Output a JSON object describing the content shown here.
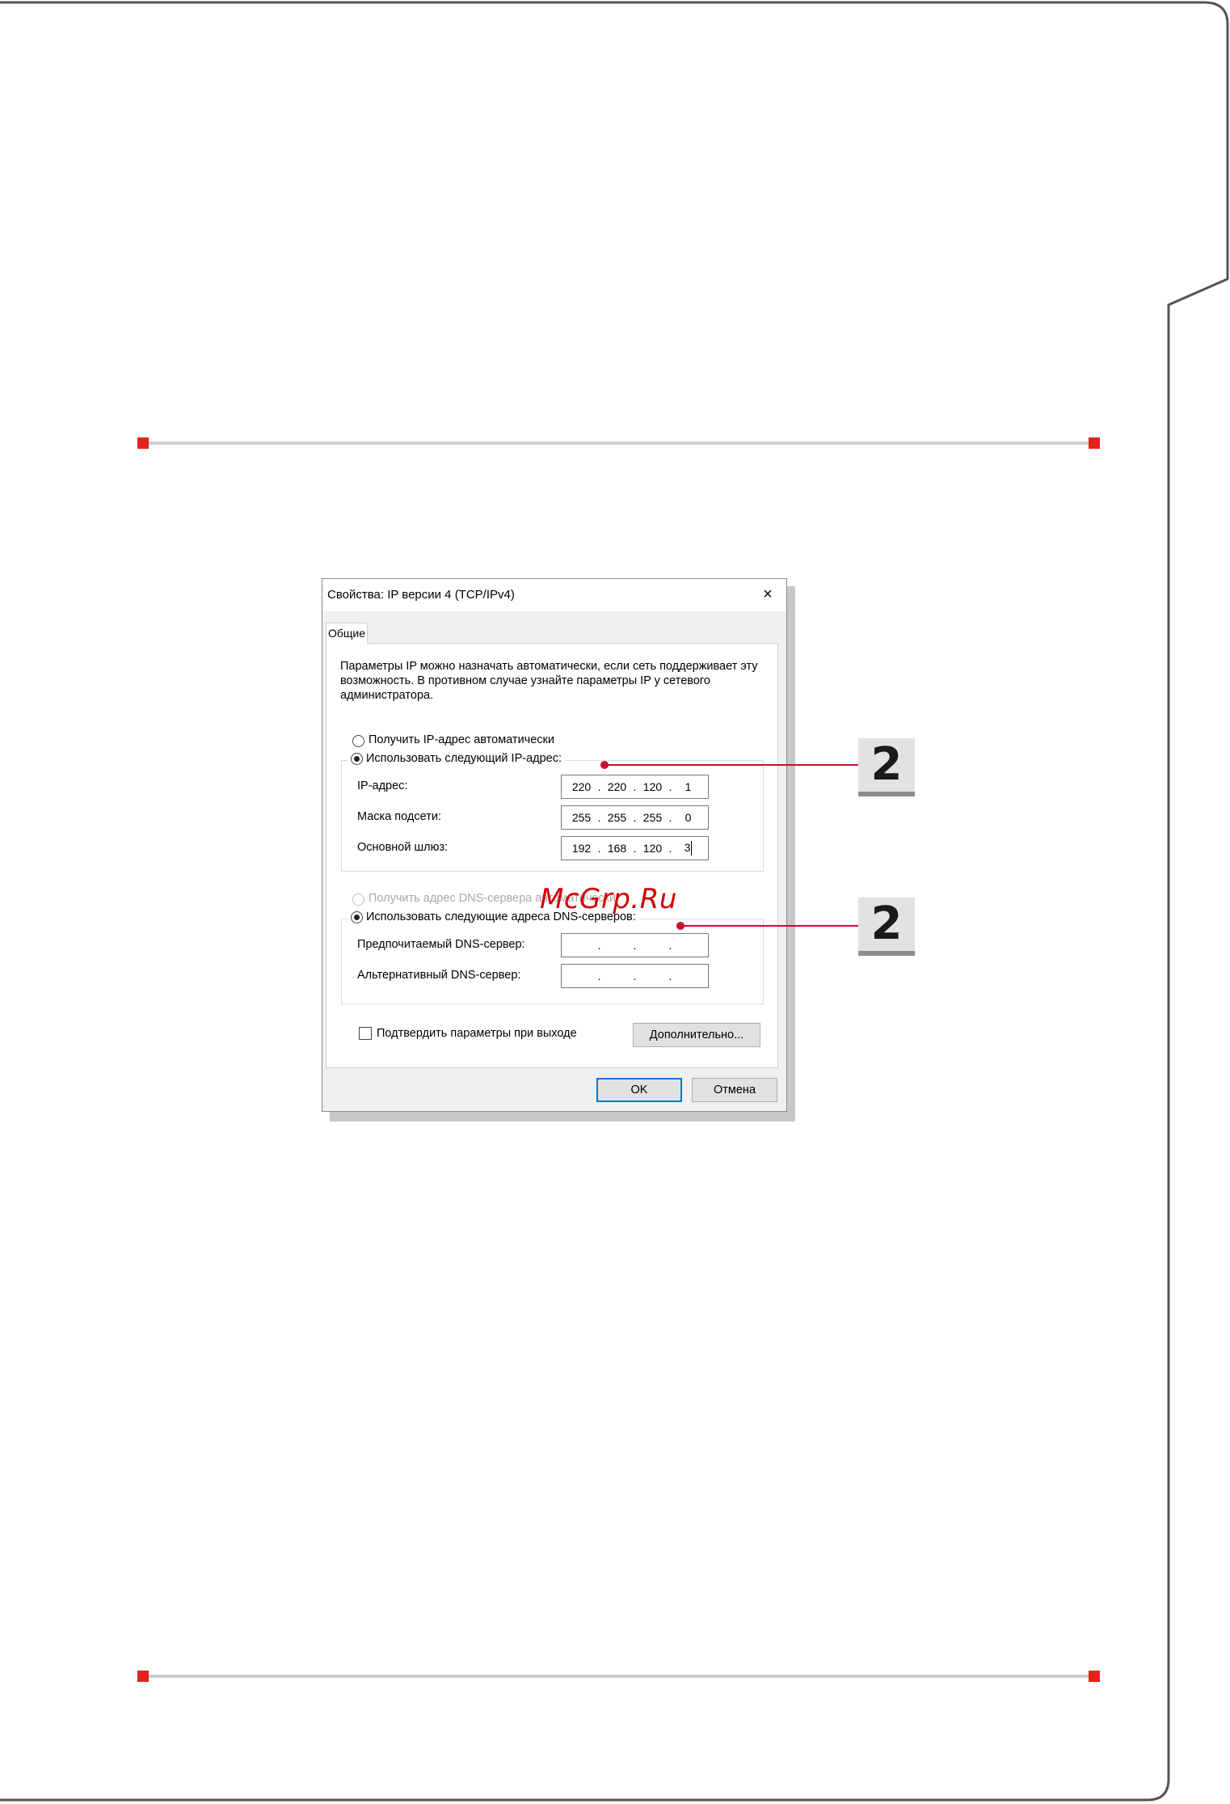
{
  "colors": {
    "accent_red": "#e2231a",
    "callout_red": "#c8102e",
    "focus_blue": "#0078d7"
  },
  "dialog": {
    "title": "Свойства: IP версии 4 (TCP/IPv4)",
    "close_glyph": "×",
    "tab_label": "Общие",
    "description": "Параметры IP можно назначать автоматически, если сеть поддерживает эту возможность. В противном случае узнайте параметры IP у сетевого администратора.",
    "ip_auto_label": "Получить IP-адрес автоматически",
    "ip_manual_label": "Использовать следующий IP-адрес:",
    "ip_address_label": "IP-адрес:",
    "ip_address": [
      "220",
      "220",
      "120",
      "1"
    ],
    "subnet_label": "Маска подсети:",
    "subnet": [
      "255",
      "255",
      "255",
      "0"
    ],
    "gateway_label": "Основной шлюз:",
    "gateway": [
      "192",
      "168",
      "120",
      "3"
    ],
    "dns_auto_label": "Получить адрес DNS-сервера автоматически",
    "dns_manual_label": "Использовать следующие адреса DNS-серверов:",
    "dns_preferred_label": "Предпочитаемый DNS-сервер:",
    "dns_alternate_label": "Альтернативный DNS-сервер:",
    "validate_label": "Подтвердить параметры при выходе",
    "advanced_button": "Дополнительно...",
    "ok_button": "OK",
    "cancel_button": "Отмена"
  },
  "callouts": {
    "step_ip": "2",
    "step_dns": "2"
  },
  "watermark": "McGrp.Ru"
}
